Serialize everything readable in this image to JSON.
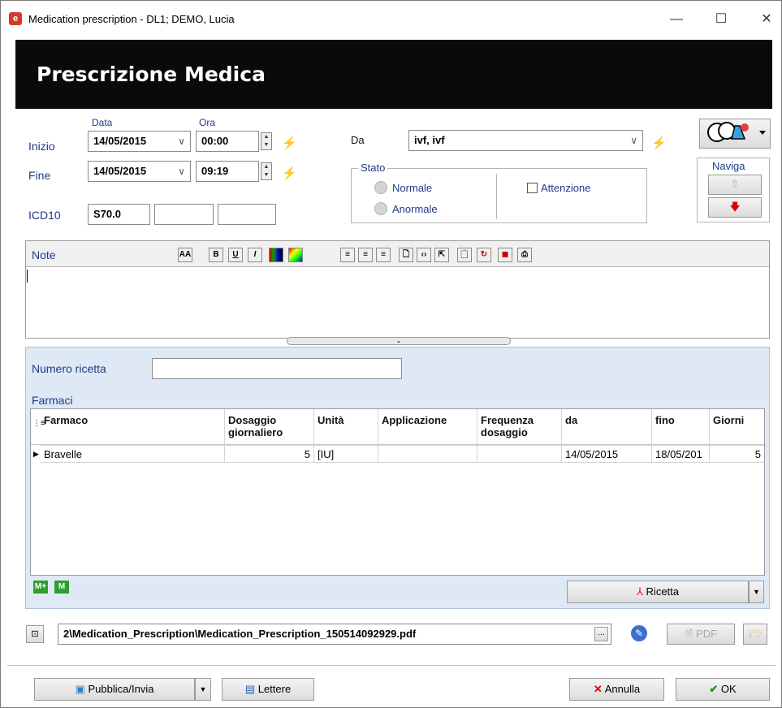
{
  "window": {
    "title": "Medication prescription - DL1; DEMO, Lucia",
    "app_icon": "app-logo-icon",
    "minimize": "—",
    "maximize": "☐",
    "close": "✕"
  },
  "banner": {
    "title": "Prescrizione Medica"
  },
  "dates": {
    "col_data": "Data",
    "col_ora": "Ora",
    "inizio_label": "Inizio",
    "inizio_date": "14/05/2015",
    "inizio_time": "00:00",
    "fine_label": "Fine",
    "fine_date": "14/05/2015",
    "fine_time": "09:19",
    "icd10_label": "ICD10",
    "icd10_code": "S70.0",
    "icd10_code2": "",
    "icd10_code3": ""
  },
  "da": {
    "label": "Da",
    "value": "ivf, ivf"
  },
  "stato": {
    "label": "Stato",
    "normale": "Normale",
    "anormale": "Anormale",
    "attenzione": "Attenzione"
  },
  "naviga": {
    "label": "Naviga",
    "up_icon": "arrow-up-icon",
    "down_icon": "arrow-down-icon"
  },
  "note": {
    "label": "Note",
    "toolbar": {
      "font": "AA",
      "bold": "B",
      "underline": "U",
      "italic": "I"
    },
    "content": ""
  },
  "ricetta": {
    "numero_label": "Numero ricetta",
    "numero_value": "",
    "farmaci_label": "Farmaci",
    "columns": [
      "Farmaco",
      "Dosaggio giornaliero",
      "Unità",
      "Applicazione",
      "Frequenza dosaggio",
      "da",
      "fino",
      "Giorni"
    ],
    "rows": [
      [
        "Bravelle",
        "5",
        "[IU]",
        "",
        "",
        "14/05/2015",
        "18/05/201",
        "5"
      ]
    ],
    "ricetta_button": "Ricetta"
  },
  "file": {
    "path": "2\\Medication_Prescription\\Medication_Prescription_150514092929.pdf",
    "browse": "...",
    "pdf_button": "PDF"
  },
  "footer": {
    "pubblica": "Pubblica/Invia",
    "lettere": "Lettere",
    "annulla": "Annulla",
    "ok": "OK"
  },
  "colors": {
    "banner_bg": "#0a0a0a",
    "panel_bg": "#dfe9f5",
    "label_blue": "#1f3a8a"
  }
}
